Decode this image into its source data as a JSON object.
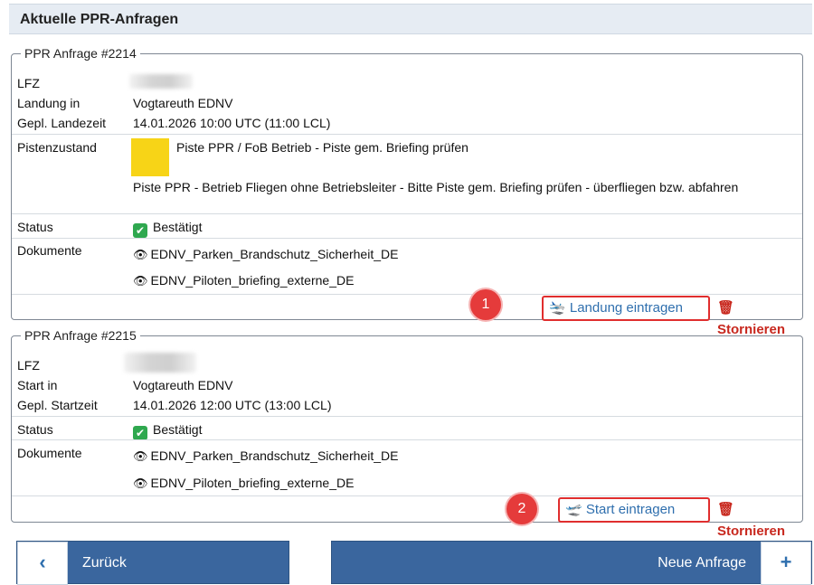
{
  "header": {
    "title": "Aktuelle PPR-Anfragen"
  },
  "requests": [
    {
      "legend": "PPR Anfrage #2214",
      "lfz_label": "LFZ",
      "location_label": "Landung in",
      "location_value": "Vogtareuth EDNV",
      "time_label": "Gepl. Landezeit",
      "time_value": "14.01.2026 10:00 UTC (11:00 LCL)",
      "runway_label": "Pistenzustand",
      "runway_title": "Piste PPR / FoB Betrieb - Piste gem. Briefing prüfen",
      "runway_desc": "Piste PPR - Betrieb Fliegen ohne Betriebsleiter - Bitte Piste gem. Briefing prüfen - überfliegen bzw. abfahren",
      "runway_color": "#f7d417",
      "status_label": "Status",
      "status_value": "Bestätigt",
      "docs_label": "Dokumente",
      "docs": [
        "EDNV_Parken_Brandschutz_Sicherheit_DE",
        "EDNV_Piloten_briefing_externe_DE"
      ],
      "action_label": "Landung eintragen",
      "cancel_label": "Stornieren",
      "marker": "1"
    },
    {
      "legend": "PPR Anfrage #2215",
      "lfz_label": "LFZ",
      "location_label": "Start in",
      "location_value": "Vogtareuth EDNV",
      "time_label": "Gepl. Startzeit",
      "time_value": "14.01.2026 12:00 UTC (13:00 LCL)",
      "status_label": "Status",
      "status_value": "Bestätigt",
      "docs_label": "Dokumente",
      "docs": [
        "EDNV_Parken_Brandschutz_Sicherheit_DE",
        "EDNV_Piloten_briefing_externe_DE"
      ],
      "action_label": "Start eintragen",
      "cancel_label": "Stornieren",
      "marker": "2"
    }
  ],
  "nav": {
    "back_label": "Zurück",
    "new_label": "Neue Anfrage"
  },
  "colors": {
    "accent": "#3a669e",
    "highlight": "#e02e2e",
    "status_ok": "#2fa84f",
    "danger": "#c8281e"
  }
}
